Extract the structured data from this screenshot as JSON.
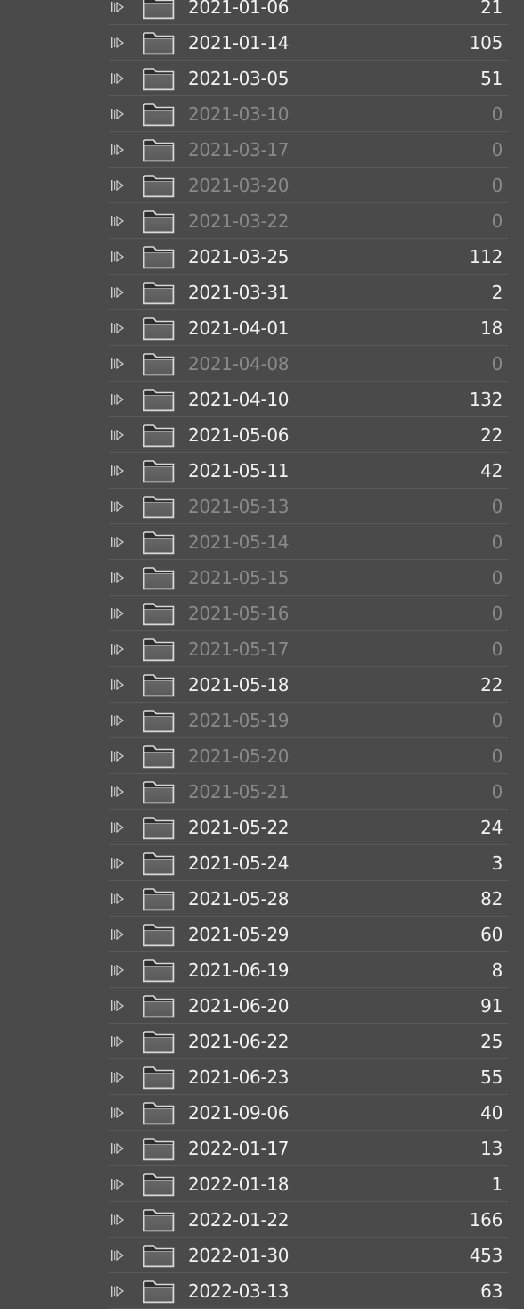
{
  "folders": [
    {
      "name": "2021-01-06",
      "count": "21",
      "empty": false
    },
    {
      "name": "2021-01-14",
      "count": "105",
      "empty": false
    },
    {
      "name": "2021-03-05",
      "count": "51",
      "empty": false
    },
    {
      "name": "2021-03-10",
      "count": "0",
      "empty": true
    },
    {
      "name": "2021-03-17",
      "count": "0",
      "empty": true
    },
    {
      "name": "2021-03-20",
      "count": "0",
      "empty": true
    },
    {
      "name": "2021-03-22",
      "count": "0",
      "empty": true
    },
    {
      "name": "2021-03-25",
      "count": "112",
      "empty": false
    },
    {
      "name": "2021-03-31",
      "count": "2",
      "empty": false
    },
    {
      "name": "2021-04-01",
      "count": "18",
      "empty": false
    },
    {
      "name": "2021-04-08",
      "count": "0",
      "empty": true
    },
    {
      "name": "2021-04-10",
      "count": "132",
      "empty": false
    },
    {
      "name": "2021-05-06",
      "count": "22",
      "empty": false
    },
    {
      "name": "2021-05-11",
      "count": "42",
      "empty": false
    },
    {
      "name": "2021-05-13",
      "count": "0",
      "empty": true
    },
    {
      "name": "2021-05-14",
      "count": "0",
      "empty": true
    },
    {
      "name": "2021-05-15",
      "count": "0",
      "empty": true
    },
    {
      "name": "2021-05-16",
      "count": "0",
      "empty": true
    },
    {
      "name": "2021-05-17",
      "count": "0",
      "empty": true
    },
    {
      "name": "2021-05-18",
      "count": "22",
      "empty": false
    },
    {
      "name": "2021-05-19",
      "count": "0",
      "empty": true
    },
    {
      "name": "2021-05-20",
      "count": "0",
      "empty": true
    },
    {
      "name": "2021-05-21",
      "count": "0",
      "empty": true
    },
    {
      "name": "2021-05-22",
      "count": "24",
      "empty": false
    },
    {
      "name": "2021-05-24",
      "count": "3",
      "empty": false
    },
    {
      "name": "2021-05-28",
      "count": "82",
      "empty": false
    },
    {
      "name": "2021-05-29",
      "count": "60",
      "empty": false
    },
    {
      "name": "2021-06-19",
      "count": "8",
      "empty": false
    },
    {
      "name": "2021-06-20",
      "count": "91",
      "empty": false
    },
    {
      "name": "2021-06-22",
      "count": "25",
      "empty": false
    },
    {
      "name": "2021-06-23",
      "count": "55",
      "empty": false
    },
    {
      "name": "2021-09-06",
      "count": "40",
      "empty": false
    },
    {
      "name": "2022-01-17",
      "count": "13",
      "empty": false
    },
    {
      "name": "2022-01-18",
      "count": "1",
      "empty": false
    },
    {
      "name": "2022-01-22",
      "count": "166",
      "empty": false
    },
    {
      "name": "2022-01-30",
      "count": "453",
      "empty": false
    },
    {
      "name": "2022-03-13",
      "count": "63",
      "empty": false
    }
  ],
  "icons": {
    "expander": "expand-arrow-icon",
    "folder": "folder-icon"
  },
  "colors": {
    "background": "#4a4a4a",
    "text_active": "#f2f2f2",
    "text_empty": "#8a8a8a",
    "separator": "#5b5b5b"
  }
}
